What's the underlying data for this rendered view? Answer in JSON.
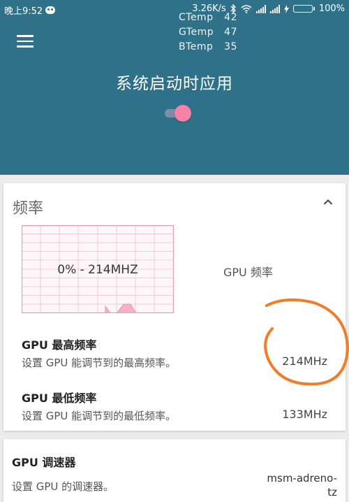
{
  "status_bar": {
    "time": "晚上9:52",
    "net_speed": "3.26K/s",
    "battery_pct": "100%",
    "battery_level": 1.0
  },
  "temps": [
    {
      "label": "CTemp",
      "value": "42"
    },
    {
      "label": "GTemp",
      "value": "47"
    },
    {
      "label": "BTemp",
      "value": "35"
    }
  ],
  "header": {
    "title": "系统启动时应用",
    "toggle_on": true
  },
  "frequency_card": {
    "title": "频率",
    "graph_label": "0% - 214MHZ",
    "gpu_freq_label": "GPU 频率",
    "max": {
      "title": "GPU 最高频率",
      "subtitle": "设置 GPU 能调节到的最高频率。",
      "value": "214MHz"
    },
    "min": {
      "title": "GPU 最低频率",
      "subtitle": "设置 GPU 能调节到的最低频率。",
      "value": "133MHz"
    }
  },
  "governor_card": {
    "title": "GPU 调速器",
    "subtitle": "设置 GPU 的调速器。",
    "value": "msm-adreno-tz"
  },
  "colors": {
    "header_bg": "#2f7188",
    "toggle_thumb": "#f582a6",
    "graph_line": "#e896ad",
    "annotation": "#f07d2a"
  }
}
